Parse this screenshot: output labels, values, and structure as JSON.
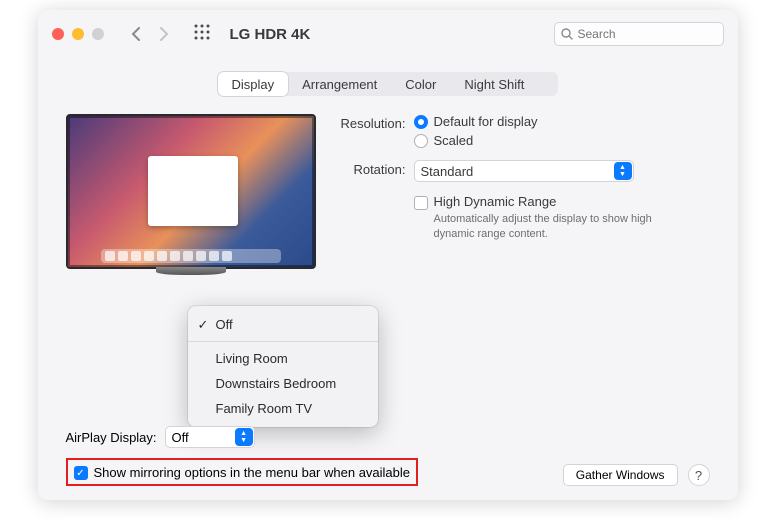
{
  "window_title": "LG HDR 4K",
  "search": {
    "placeholder": "Search"
  },
  "tabs": [
    "Display",
    "Arrangement",
    "Color",
    "Night Shift"
  ],
  "active_tab_index": 0,
  "resolution": {
    "label": "Resolution:",
    "default_label": "Default for display",
    "scaled_label": "Scaled",
    "selected": "default"
  },
  "rotation": {
    "label": "Rotation:",
    "value": "Standard"
  },
  "hdr": {
    "label": "High Dynamic Range",
    "hint": "Automatically adjust the display to show high dynamic range content."
  },
  "airplay": {
    "label": "AirPlay Display:",
    "value": "Off",
    "menu": [
      "Off",
      "Living Room",
      "Downstairs Bedroom",
      "Family Room TV"
    ],
    "menu_selected_index": 0
  },
  "mirroring_checkbox_label": "Show mirroring options in the menu bar when available",
  "mirroring_checked": true,
  "gather_button": "Gather Windows",
  "help_label": "?"
}
